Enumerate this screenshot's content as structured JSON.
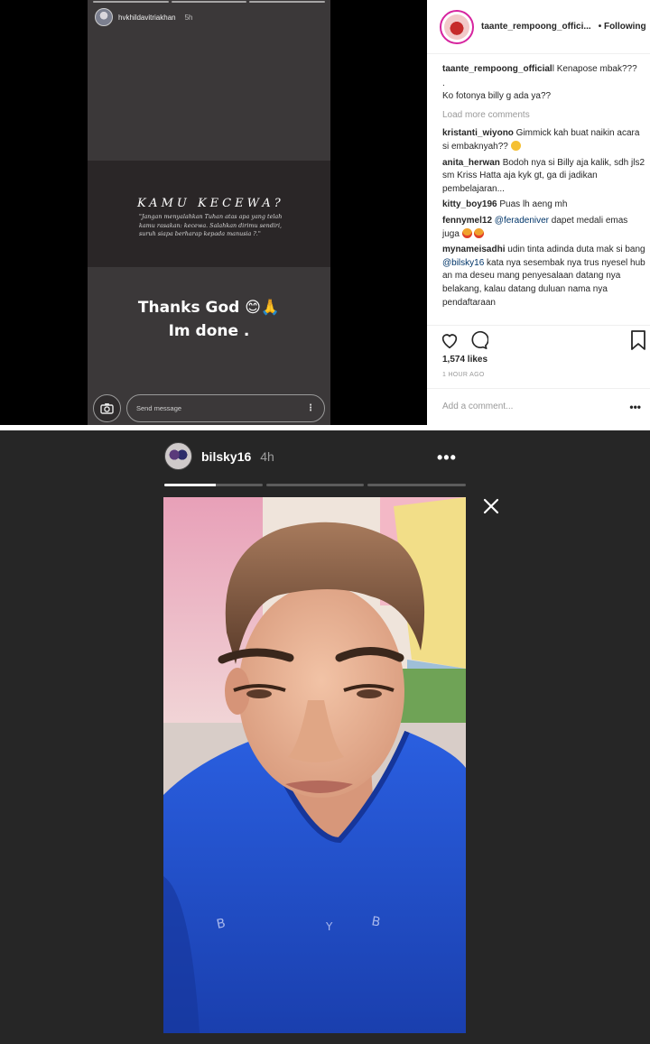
{
  "top_story": {
    "username": "hvkhildavitriakhan",
    "time": "5h",
    "quote_title": "KAMU KECEWA?",
    "quote_body": "\"Jangan menyalahkan Tuhan atas apa yang telah kamu rasakan: kecewa. Salahkan dirimu sendiri, suruh siapa berharap kepada manusia ?.\"",
    "thanks_line1": "Thanks God 😊🙏",
    "thanks_line2": "Im done .",
    "send_placeholder": "Send message",
    "camera_icon": "camera-icon",
    "more_icon": "more-vertical-icon"
  },
  "post": {
    "username": "taante_rempoong_offici...",
    "follow_label": "• Following",
    "caption_user": "taante_rempoong_official",
    "caption_text": "l Kenapose mbak???",
    "caption_dot": ".",
    "caption_line3": "Ko fotonya billy g ada ya??",
    "load_more": "Load more comments",
    "comments": [
      {
        "user": "kristanti_wiyono",
        "text": " Gimmick kah buat naikin acara si embaknyah?? "
      },
      {
        "user": "anita_herwan",
        "text": " Bodoh nya si Billy aja kalik, sdh jls2 sm Kriss Hatta aja kyk gt, ga di jadikan pembelajaran..."
      },
      {
        "user": "kitty_boy196",
        "text": " Puas lh aeng mh"
      },
      {
        "user": "fennymel12",
        "mention": " @feradeniver",
        "text": " dapet medali emas juga "
      },
      {
        "user": "mynameisadhi",
        "text": " udin tinta adinda duta mak si bang ",
        "mention": "@bilsky16",
        "text2": " kata nya sesembak nya trus nyesel hub an ma deseu mang penyesalaan datang nya belakang, kalau datang duluan nama nya pendaftaraan"
      }
    ],
    "likes": "1,574 likes",
    "time_ago": "1 HOUR AGO",
    "add_comment_placeholder": "Add a comment...",
    "add_comment_more": "•••"
  },
  "bottom_story": {
    "username": "bilsky16",
    "time": "4h",
    "menu_label": "•••",
    "close_icon": "close-icon",
    "progress": [
      0.52,
      0,
      0
    ]
  },
  "colors": {
    "story_bg": "#3b3839",
    "viewer_bg": "#262626",
    "shirt_blue": "#1f4fd0",
    "ig_gradient": "#d6249f"
  }
}
